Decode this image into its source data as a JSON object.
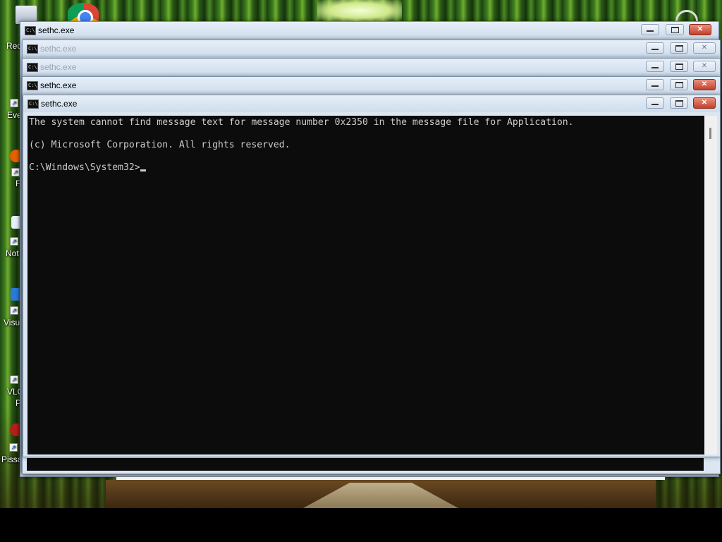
{
  "desktop": {
    "icons": [
      {
        "label": "Rec",
        "icon": "recycle-bin-icon"
      },
      {
        "label": "Eve",
        "icon": "event-viewer-icon"
      },
      {
        "label": "F",
        "icon": "firefox-icon"
      },
      {
        "label": "Not",
        "icon": "notepad-icon"
      },
      {
        "label": "Visu",
        "icon": "visual-studio-icon"
      },
      {
        "label": "VLC",
        "icon": "vlc-icon"
      },
      {
        "label": "Pl",
        "icon": "vlc-icon"
      },
      {
        "label": "Pissa",
        "icon": "pissa-icon"
      }
    ]
  },
  "windows": [
    {
      "title": "sethc.exe",
      "state": "active-behind"
    },
    {
      "title": "sethc.exe",
      "state": "inactive"
    },
    {
      "title": "sethc.exe",
      "state": "inactive"
    },
    {
      "title": "sethc.exe",
      "state": "active-behind"
    },
    {
      "title": "sethc.exe",
      "state": "focused"
    }
  ],
  "console": {
    "lines": [
      "The system cannot find message text for message number 0x2350 in the message file for Application.",
      "",
      "(c) Microsoft Corporation. All rights reserved.",
      "",
      "C:\\Windows\\System32>"
    ],
    "background": "#0c0c0c",
    "foreground": "#cccccc"
  },
  "controls": {
    "minimize": "—",
    "close": "✕"
  },
  "colors": {
    "close_active": "#c2412c",
    "titlebar": "#d5e2f0"
  }
}
